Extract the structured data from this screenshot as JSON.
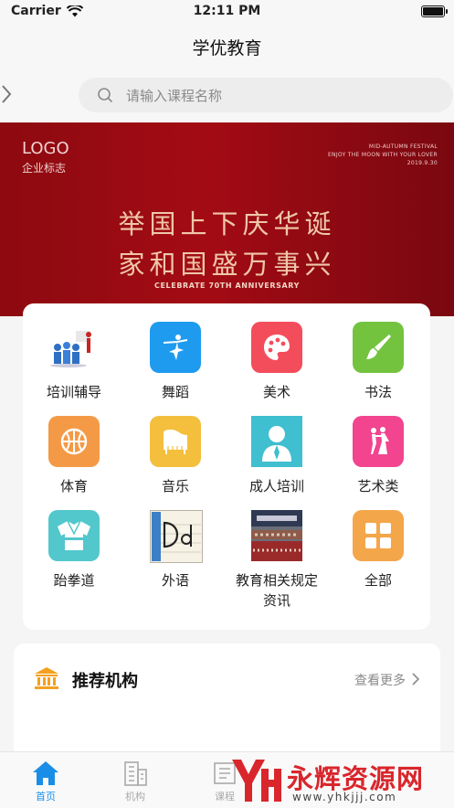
{
  "status_bar": {
    "carrier": "Carrier",
    "time": "12:11 PM"
  },
  "nav": {
    "title": "学优教育"
  },
  "search": {
    "placeholder": "请输入课程名称"
  },
  "banner": {
    "logo": "LOGO",
    "logo_sub": "企业标志",
    "festival_lines": [
      "MID-AUTUMN FESTIVAL",
      "ENJOY THE MOON WITH YOUR LOVER",
      "2019.9.30"
    ],
    "headline_1": "举国上下庆华诞",
    "headline_2": "家和国盛万事兴",
    "caption": "CELEBRATE 70TH ANNIVERSARY"
  },
  "categories": [
    {
      "label": "培训辅导",
      "icon": "training-people-icon"
    },
    {
      "label": "舞蹈",
      "icon": "ballet-dancer-icon",
      "color": "#1e9bef"
    },
    {
      "label": "美术",
      "icon": "palette-icon",
      "color": "#f34d5b"
    },
    {
      "label": "书法",
      "icon": "brush-icon",
      "color": "#74c33f"
    },
    {
      "label": "体育",
      "icon": "basketball-icon",
      "color": "#f49a47"
    },
    {
      "label": "音乐",
      "icon": "piano-icon",
      "color": "#f3bf3d"
    },
    {
      "label": "成人培训",
      "icon": "adult-person-icon",
      "color": "#3fbfcf"
    },
    {
      "label": "艺术类",
      "icon": "dancing-couple-icon",
      "color": "#f2448f"
    },
    {
      "label": "跆拳道",
      "icon": "taekwondo-uniform-icon",
      "color": "#52c7cc"
    },
    {
      "label": "外语",
      "icon": "letters-dd-icon"
    },
    {
      "label": "教育相关规定资讯",
      "icon": "conference-photo-icon"
    },
    {
      "label": "全部",
      "icon": "grid-all-icon",
      "color": "#f4a64a"
    }
  ],
  "recommend": {
    "title": "推荐机构",
    "more": "查看更多"
  },
  "tabbar": {
    "home": "首页",
    "org": "机构",
    "course": "课程",
    "accent": "#1a8ee6"
  },
  "watermark": {
    "text": "永辉资源网",
    "url": "www.yhkjjj.com"
  }
}
